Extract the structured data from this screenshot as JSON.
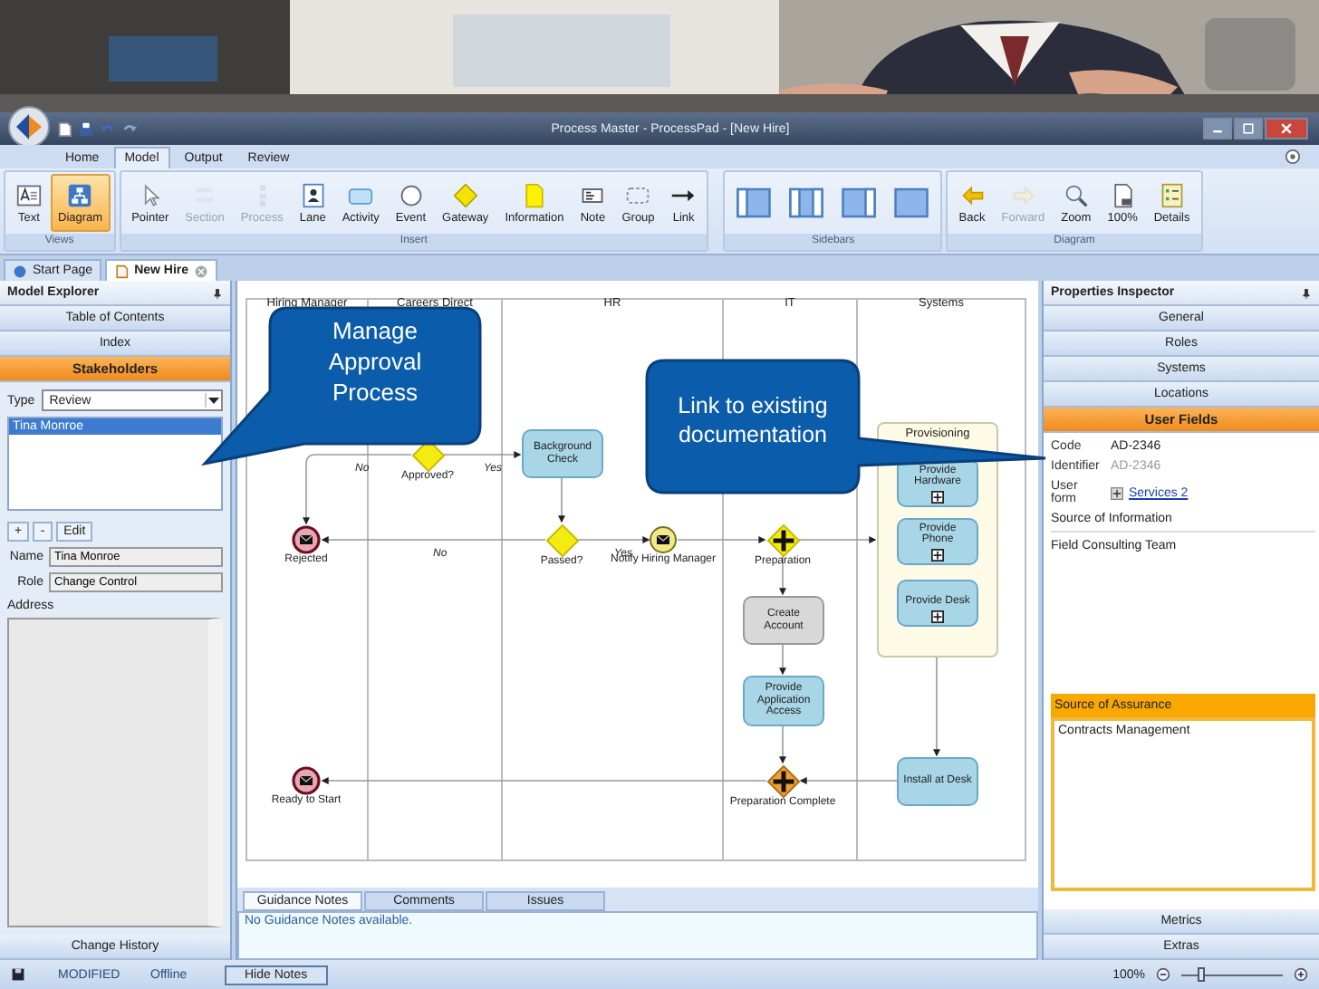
{
  "title_bar": {
    "title": "Process Master - ProcessPad - [New Hire]"
  },
  "ribbon_tabs": [
    {
      "label": "Home",
      "selected": false
    },
    {
      "label": "Model",
      "selected": true
    },
    {
      "label": "Output",
      "selected": false
    },
    {
      "label": "Review",
      "selected": false
    }
  ],
  "ribbon_groups": [
    {
      "label": "Views",
      "buttons": [
        {
          "kind": "text",
          "label": "Text",
          "selected": false,
          "disabled": false
        },
        {
          "kind": "diagram",
          "label": "Diagram",
          "selected": true,
          "disabled": false
        }
      ]
    },
    {
      "label": "Insert",
      "buttons": [
        {
          "kind": "pointer",
          "label": "Pointer",
          "selected": false,
          "disabled": false
        },
        {
          "kind": "section",
          "label": "Section",
          "selected": false,
          "disabled": true
        },
        {
          "kind": "process",
          "label": "Process",
          "selected": false,
          "disabled": true
        },
        {
          "kind": "lane",
          "label": "Lane",
          "selected": false,
          "disabled": false
        },
        {
          "kind": "activity",
          "label": "Activity",
          "selected": false,
          "disabled": false
        },
        {
          "kind": "event",
          "label": "Event",
          "selected": false,
          "disabled": false
        },
        {
          "kind": "gateway",
          "label": "Gateway",
          "selected": false,
          "disabled": false
        },
        {
          "kind": "information",
          "label": "Information",
          "selected": false,
          "disabled": false
        },
        {
          "kind": "note",
          "label": "Note",
          "selected": false,
          "disabled": false
        },
        {
          "kind": "group",
          "label": "Group",
          "selected": false,
          "disabled": false
        },
        {
          "kind": "link",
          "label": "Link",
          "selected": false,
          "disabled": false
        }
      ]
    },
    {
      "label": "Sidebars",
      "buttons": [
        {
          "kind": "sidebar-left",
          "selected": false,
          "disabled": false
        },
        {
          "kind": "sidebar-both",
          "selected": false,
          "disabled": false
        },
        {
          "kind": "sidebar-right",
          "selected": false,
          "disabled": false
        },
        {
          "kind": "sidebar-none",
          "selected": false,
          "disabled": false
        }
      ]
    },
    {
      "label": "Diagram",
      "buttons": [
        {
          "kind": "back",
          "label": "Back",
          "selected": false,
          "disabled": false
        },
        {
          "kind": "forward",
          "label": "Forward",
          "selected": false,
          "disabled": true
        },
        {
          "kind": "zoom",
          "label": "Zoom",
          "selected": false,
          "disabled": false
        },
        {
          "kind": "actual-size",
          "label": "100%",
          "selected": false,
          "disabled": false
        },
        {
          "kind": "details",
          "label": "Details",
          "selected": false,
          "disabled": false
        }
      ]
    }
  ],
  "document_tabs": [
    {
      "label": "Start Page",
      "selected": false
    },
    {
      "label": "New Hire",
      "selected": true
    }
  ],
  "model_explorer": {
    "title": "Model Explorer",
    "sections": [
      {
        "label": "Table of Contents",
        "selected": false
      },
      {
        "label": "Index",
        "selected": false
      },
      {
        "label": "Stakeholders",
        "selected": true
      }
    ],
    "type_label": "Type",
    "type_value": "Review",
    "stakeholders": [
      {
        "name": "Tina Monroe",
        "selected": true
      }
    ],
    "buttons": [
      "+",
      "-",
      "Edit"
    ],
    "name_label": "Name",
    "name_value": "Tina Monroe",
    "role_label": "Role",
    "role_value": "Change Control",
    "address_label": "Address",
    "footer_button": "Change History"
  },
  "diagram": {
    "lanes": [
      "Hiring Manager",
      "Careers Direct",
      "HR",
      "IT",
      "Systems"
    ],
    "nodes": [
      {
        "kind": "gateway",
        "label": "Approved?",
        "parallel": false,
        "highlighted": false
      },
      {
        "kind": "activity",
        "label": "Background Check",
        "greyed": false,
        "subprocess": false
      },
      {
        "kind": "group",
        "label": "Provisioning"
      },
      {
        "kind": "activity",
        "label": "Provide Hardware",
        "greyed": false,
        "subprocess": true
      },
      {
        "kind": "event",
        "label": "Rejected",
        "end": true
      },
      {
        "kind": "gateway",
        "label": "Passed?",
        "parallel": false,
        "highlighted": false
      },
      {
        "kind": "event",
        "label": "Notify Hiring Manager",
        "end": false
      },
      {
        "kind": "gateway",
        "label": "Preparation",
        "parallel": true,
        "highlighted": false
      },
      {
        "kind": "activity",
        "label": "Provide Phone",
        "greyed": false,
        "subprocess": true
      },
      {
        "kind": "activity",
        "label": "Provide Desk",
        "greyed": false,
        "subprocess": true
      },
      {
        "kind": "activity",
        "label": "Create Account",
        "greyed": true,
        "subprocess": false
      },
      {
        "kind": "activity",
        "label": "Provide Application Access",
        "greyed": false,
        "subprocess": false
      },
      {
        "kind": "event",
        "label": "Ready to Start",
        "end": true
      },
      {
        "kind": "gateway",
        "label": "Preparation Complete",
        "parallel": true,
        "highlighted": true
      },
      {
        "kind": "activity",
        "label": "Install at Desk",
        "greyed": false,
        "subprocess": false
      }
    ],
    "flow_labels": [
      "No",
      "Yes",
      "No",
      "Yes"
    ],
    "callouts": [
      "Manage Approval Process",
      "Link to existing documentation"
    ]
  },
  "properties_inspector": {
    "title": "Properties Inspector",
    "sections": [
      {
        "label": "General",
        "selected": false
      },
      {
        "label": "Roles",
        "selected": false
      },
      {
        "label": "Systems",
        "selected": false
      },
      {
        "label": "Locations",
        "selected": false
      },
      {
        "label": "User Fields",
        "selected": true
      }
    ],
    "fields": [
      {
        "label": "Code",
        "value": "AD-2346",
        "disabled": false
      },
      {
        "label": "Identifier",
        "value": "AD-2346",
        "disabled": true
      }
    ],
    "user_form": {
      "label": "User form",
      "link": "Services 2"
    },
    "source_of_information": {
      "label": "Source of Information",
      "value": "Field Consulting Team"
    },
    "source_of_assurance": {
      "label": "Source of Assurance",
      "value": "Contracts Management"
    },
    "footer_sections": [
      "Metrics",
      "Extras"
    ]
  },
  "notes": {
    "tabs": [
      {
        "label": "Guidance Notes",
        "selected": true
      },
      {
        "label": "Comments",
        "selected": false
      },
      {
        "label": "Issues",
        "selected": false
      }
    ],
    "text": "No Guidance Notes available."
  },
  "status_bar": {
    "state": "MODIFIED",
    "connection": "Offline",
    "button": "Hide Notes",
    "zoom": "100%",
    "zoom_slider": {
      "level": 0.2
    }
  }
}
